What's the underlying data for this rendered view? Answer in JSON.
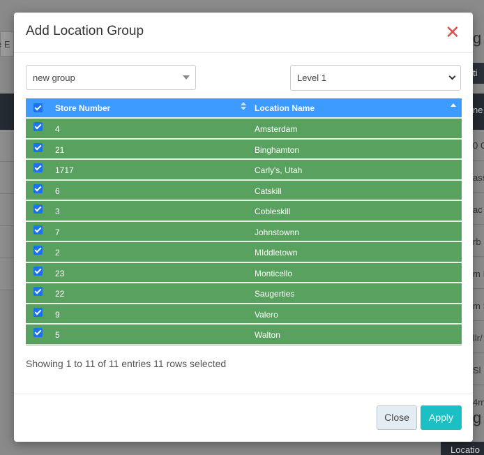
{
  "modal": {
    "title": "Add Location Group",
    "group_select_value": "new group",
    "level_select_value": "Level 1",
    "close_label": "Close",
    "apply_label": "Apply",
    "info_text": "Showing 1 to 11 of 11 entries",
    "selected_text": "11 rows selected"
  },
  "table": {
    "columns": [
      "Store Number",
      "Location Name"
    ],
    "rows": [
      {
        "store": "4",
        "location": "Amsterdam"
      },
      {
        "store": "21",
        "location": "Binghamton"
      },
      {
        "store": "1717",
        "location": "Carly's, Utah"
      },
      {
        "store": "6",
        "location": "Catskill"
      },
      {
        "store": "3",
        "location": "Cobleskill"
      },
      {
        "store": "7",
        "location": "Johnstownn"
      },
      {
        "store": "2",
        "location": "MIddletown"
      },
      {
        "store": "23",
        "location": "Monticello"
      },
      {
        "store": "22",
        "location": "Saugerties"
      },
      {
        "store": "9",
        "location": "Valero"
      },
      {
        "store": "5",
        "location": "Walton"
      }
    ]
  },
  "background": {
    "left_fragment": "e E",
    "right_title_fragment": "g",
    "right_header_fragment": "ti",
    "right_col_fragment": "ne",
    "right_rows": [
      "0 C",
      "ass",
      "ac",
      "rb",
      "m I",
      "m S",
      "llr/",
      "Sl",
      "4m"
    ],
    "right_footer_fragment": "g",
    "right_footer_dark": "Locatio"
  },
  "colors": {
    "header_blue": "#3d9bff",
    "row_green": "#58a15e",
    "apply_teal": "#1bbfc4",
    "close_red": "#d9534f"
  }
}
